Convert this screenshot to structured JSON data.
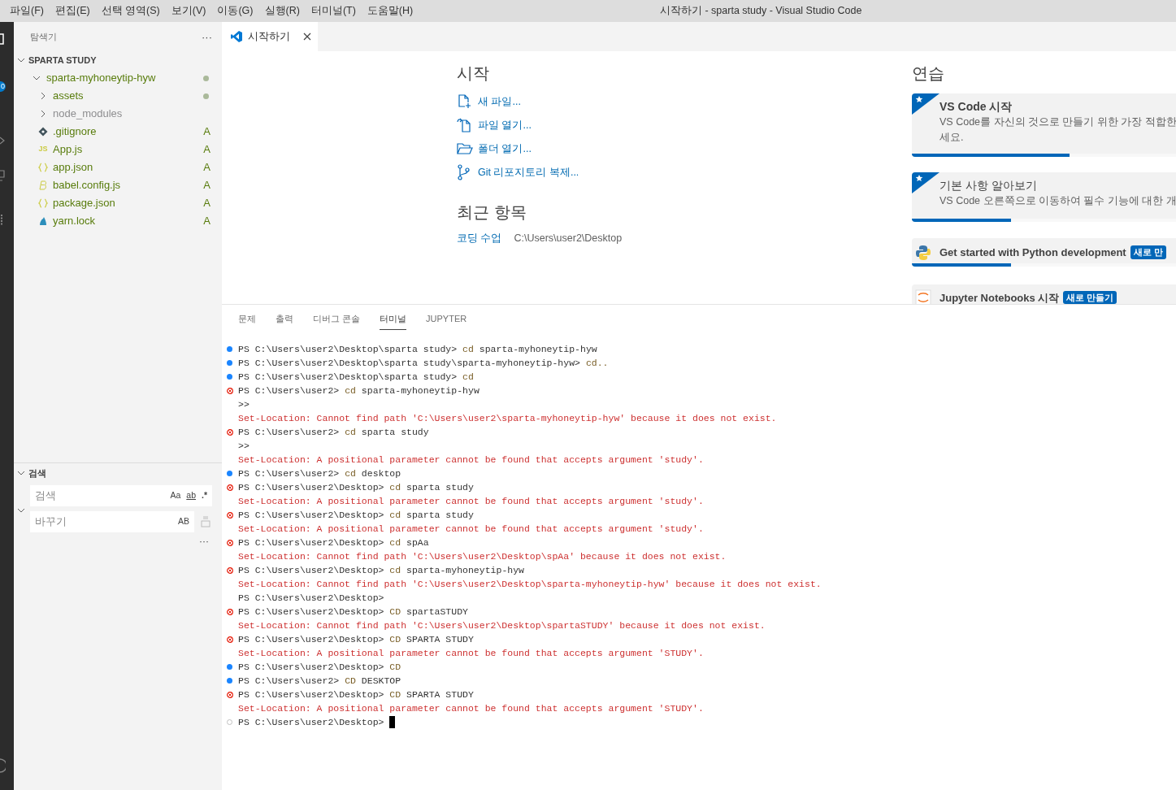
{
  "menu": [
    "파일(F)",
    "편집(E)",
    "선택 영역(S)",
    "보기(V)",
    "이동(G)",
    "실행(R)",
    "터미널(T)",
    "도움말(H)"
  ],
  "window": {
    "title": "시작하기 - sparta study - Visual Studio Code"
  },
  "activity_bar": {
    "badge": "0"
  },
  "sidebar": {
    "title": "탐색기",
    "more": "···",
    "tree": {
      "label": "SPARTA STUDY",
      "expanded": true,
      "children": [
        {
          "label": "sparta-myhoneytip-hyw",
          "kind": "folder",
          "expanded": true,
          "dot": true,
          "ignored": false,
          "children": [
            {
              "label": "assets",
              "kind": "folder",
              "expanded": false,
              "dot": true,
              "ignored": false
            },
            {
              "label": "node_modules",
              "kind": "folder",
              "expanded": false,
              "dot": false,
              "ignored": true
            },
            {
              "label": ".gitignore",
              "kind": "git",
              "status": "A",
              "ignored": false
            },
            {
              "label": "App.js",
              "kind": "js",
              "icon_text": "JS",
              "status": "A",
              "ignored": false
            },
            {
              "label": "app.json",
              "kind": "json",
              "status": "A",
              "ignored": false
            },
            {
              "label": "babel.config.js",
              "kind": "babel",
              "status": "A",
              "ignored": false
            },
            {
              "label": "package.json",
              "kind": "json",
              "status": "A",
              "ignored": false
            },
            {
              "label": "yarn.lock",
              "kind": "yarn",
              "status": "A",
              "ignored": false
            }
          ]
        }
      ]
    }
  },
  "search": {
    "title": "검색",
    "expanded": true,
    "search_placeholder": "검색",
    "toggles": [
      "Aa",
      "ab",
      ".*"
    ],
    "replace_placeholder": "바꾸기",
    "replace_toggle": "AB",
    "more": "···"
  },
  "tabs": [
    {
      "label": "시작하기",
      "selected": true
    }
  ],
  "start": {
    "heading": "시작",
    "actions": [
      {
        "kind": "new-file",
        "label": "새 파일..."
      },
      {
        "kind": "open-file",
        "label": "파일 열기..."
      },
      {
        "kind": "open-folder",
        "label": "폴더 열기..."
      },
      {
        "kind": "clone",
        "label": "Git 리포지토리 복제..."
      }
    ],
    "recent_heading": "최근 항목",
    "recent": [
      {
        "name": "코딩 수업",
        "path": "C:\\Users\\user2\\Desktop"
      }
    ]
  },
  "walkthroughs": {
    "heading": "연습",
    "cards": [
      {
        "kind": "featured",
        "title": "VS Code 시작",
        "description_lines": [
          "VS Code를 자신의 것으로 만들기 위한 가장 적합한",
          "세요."
        ],
        "level": 0.57
      },
      {
        "kind": "featured",
        "title": "기본 사항 알아보기",
        "description_lines": [
          "VS Code 오른쪽으로 이동하여 필수 기능에 대한 개"
        ],
        "level": 0.36
      },
      {
        "kind": "python",
        "title": "Get started with Python development",
        "badge": "새로 만",
        "level": 0.36
      },
      {
        "kind": "jupyter",
        "title": "Jupyter Notebooks 시작",
        "badge": "새로 만들기"
      }
    ]
  },
  "panel_tabs": [
    {
      "label": "문제",
      "selected": false
    },
    {
      "label": "출력",
      "selected": false
    },
    {
      "label": "디버그 콘솔",
      "selected": false
    },
    {
      "label": "터미널",
      "selected": true
    },
    {
      "label": "JUPYTER",
      "selected": false
    }
  ],
  "terminal": [
    {
      "kind": "prompt-ok",
      "prompt": "PS C:\\Users\\user2\\Desktop\\sparta study>",
      "command": "cd",
      "args": "sparta-myhoneytip-hyw"
    },
    {
      "kind": "prompt-ok",
      "prompt": "PS C:\\Users\\user2\\Desktop\\sparta study\\sparta-myhoneytip-hyw>",
      "command": "cd.."
    },
    {
      "kind": "prompt-ok",
      "prompt": "PS C:\\Users\\user2\\Desktop\\sparta study>",
      "command": "cd"
    },
    {
      "kind": "prompt-error",
      "prompt": "PS C:\\Users\\user2>",
      "command": "cd",
      "args": "sparta-myhoneytip-hyw"
    },
    {
      "kind": "continuation",
      "text": ">>"
    },
    {
      "kind": "error",
      "text": "Set-Location: Cannot find path 'C:\\Users\\user2\\sparta-myhoneytip-hyw' because it does not exist."
    },
    {
      "kind": "prompt-error",
      "prompt": "PS C:\\Users\\user2>",
      "command": "cd",
      "args": "sparta study"
    },
    {
      "kind": "continuation",
      "text": ">>"
    },
    {
      "kind": "error",
      "text": "Set-Location: A positional parameter cannot be found that accepts argument 'study'."
    },
    {
      "kind": "prompt-ok",
      "prompt": "PS C:\\Users\\user2>",
      "command": "cd",
      "args": "desktop"
    },
    {
      "kind": "prompt-error",
      "prompt": "PS C:\\Users\\user2\\Desktop>",
      "command": "cd",
      "args": "sparta study"
    },
    {
      "kind": "error",
      "text": "Set-Location: A positional parameter cannot be found that accepts argument 'study'."
    },
    {
      "kind": "prompt-error",
      "prompt": "PS C:\\Users\\user2\\Desktop>",
      "command": "cd",
      "args": "sparta study"
    },
    {
      "kind": "error",
      "text": "Set-Location: A positional parameter cannot be found that accepts argument 'study'."
    },
    {
      "kind": "prompt-error",
      "prompt": "PS C:\\Users\\user2\\Desktop>",
      "command": "cd",
      "args": "spAa"
    },
    {
      "kind": "error",
      "text": "Set-Location: Cannot find path 'C:\\Users\\user2\\Desktop\\spAa' because it does not exist."
    },
    {
      "kind": "prompt-error",
      "prompt": "PS C:\\Users\\user2\\Desktop>",
      "command": "cd",
      "args": "sparta-myhoneytip-hyw"
    },
    {
      "kind": "error",
      "text": "Set-Location: Cannot find path 'C:\\Users\\user2\\Desktop\\sparta-myhoneytip-hyw' because it does not exist."
    },
    {
      "kind": "prompt-plain",
      "prompt": "PS C:\\Users\\user2\\Desktop>"
    },
    {
      "kind": "prompt-error",
      "prompt": "PS C:\\Users\\user2\\Desktop>",
      "command": "CD",
      "args": "spartaSTUDY"
    },
    {
      "kind": "error",
      "text": "Set-Location: Cannot find path 'C:\\Users\\user2\\Desktop\\spartaSTUDY' because it does not exist."
    },
    {
      "kind": "prompt-error",
      "prompt": "PS C:\\Users\\user2\\Desktop>",
      "command": "CD",
      "args": "SPARTA STUDY"
    },
    {
      "kind": "error",
      "text": "Set-Location: A positional parameter cannot be found that accepts argument 'STUDY'."
    },
    {
      "kind": "prompt-ok",
      "prompt": "PS C:\\Users\\user2\\Desktop>",
      "command": "CD"
    },
    {
      "kind": "prompt-ok",
      "prompt": "PS C:\\Users\\user2>",
      "command": "CD",
      "args": "DESKTOP"
    },
    {
      "kind": "prompt-error",
      "prompt": "PS C:\\Users\\user2\\Desktop>",
      "command": "CD",
      "args": "SPARTA STUDY"
    },
    {
      "kind": "error",
      "text": "Set-Location: A positional parameter cannot be found that accepts argument 'STUDY'."
    },
    {
      "kind": "prompt-pending",
      "prompt": "PS C:\\Users\\user2\\Desktop>",
      "cursor": true
    }
  ]
}
